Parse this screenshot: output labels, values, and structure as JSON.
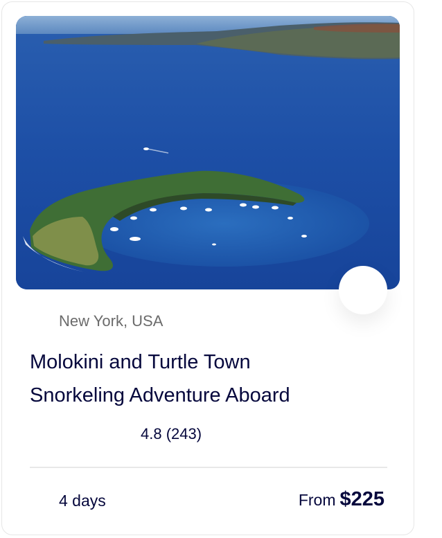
{
  "card": {
    "location": "New York, USA",
    "title_line1": "Molokini and Turtle Town",
    "title_line2": "Snorkeling Adventure Aboard",
    "rating": "4.8",
    "reviews": "(243)",
    "duration": "4 days",
    "price_prefix": "From",
    "price": "$225"
  },
  "icons": {
    "wishlist": "heart-icon",
    "location": "map-pin-icon",
    "rating": "star-icon",
    "duration": "clock-icon"
  },
  "colors": {
    "title_text": "#05073c",
    "muted_text": "#6b6b6b",
    "ocean": "#1f4fa3"
  }
}
